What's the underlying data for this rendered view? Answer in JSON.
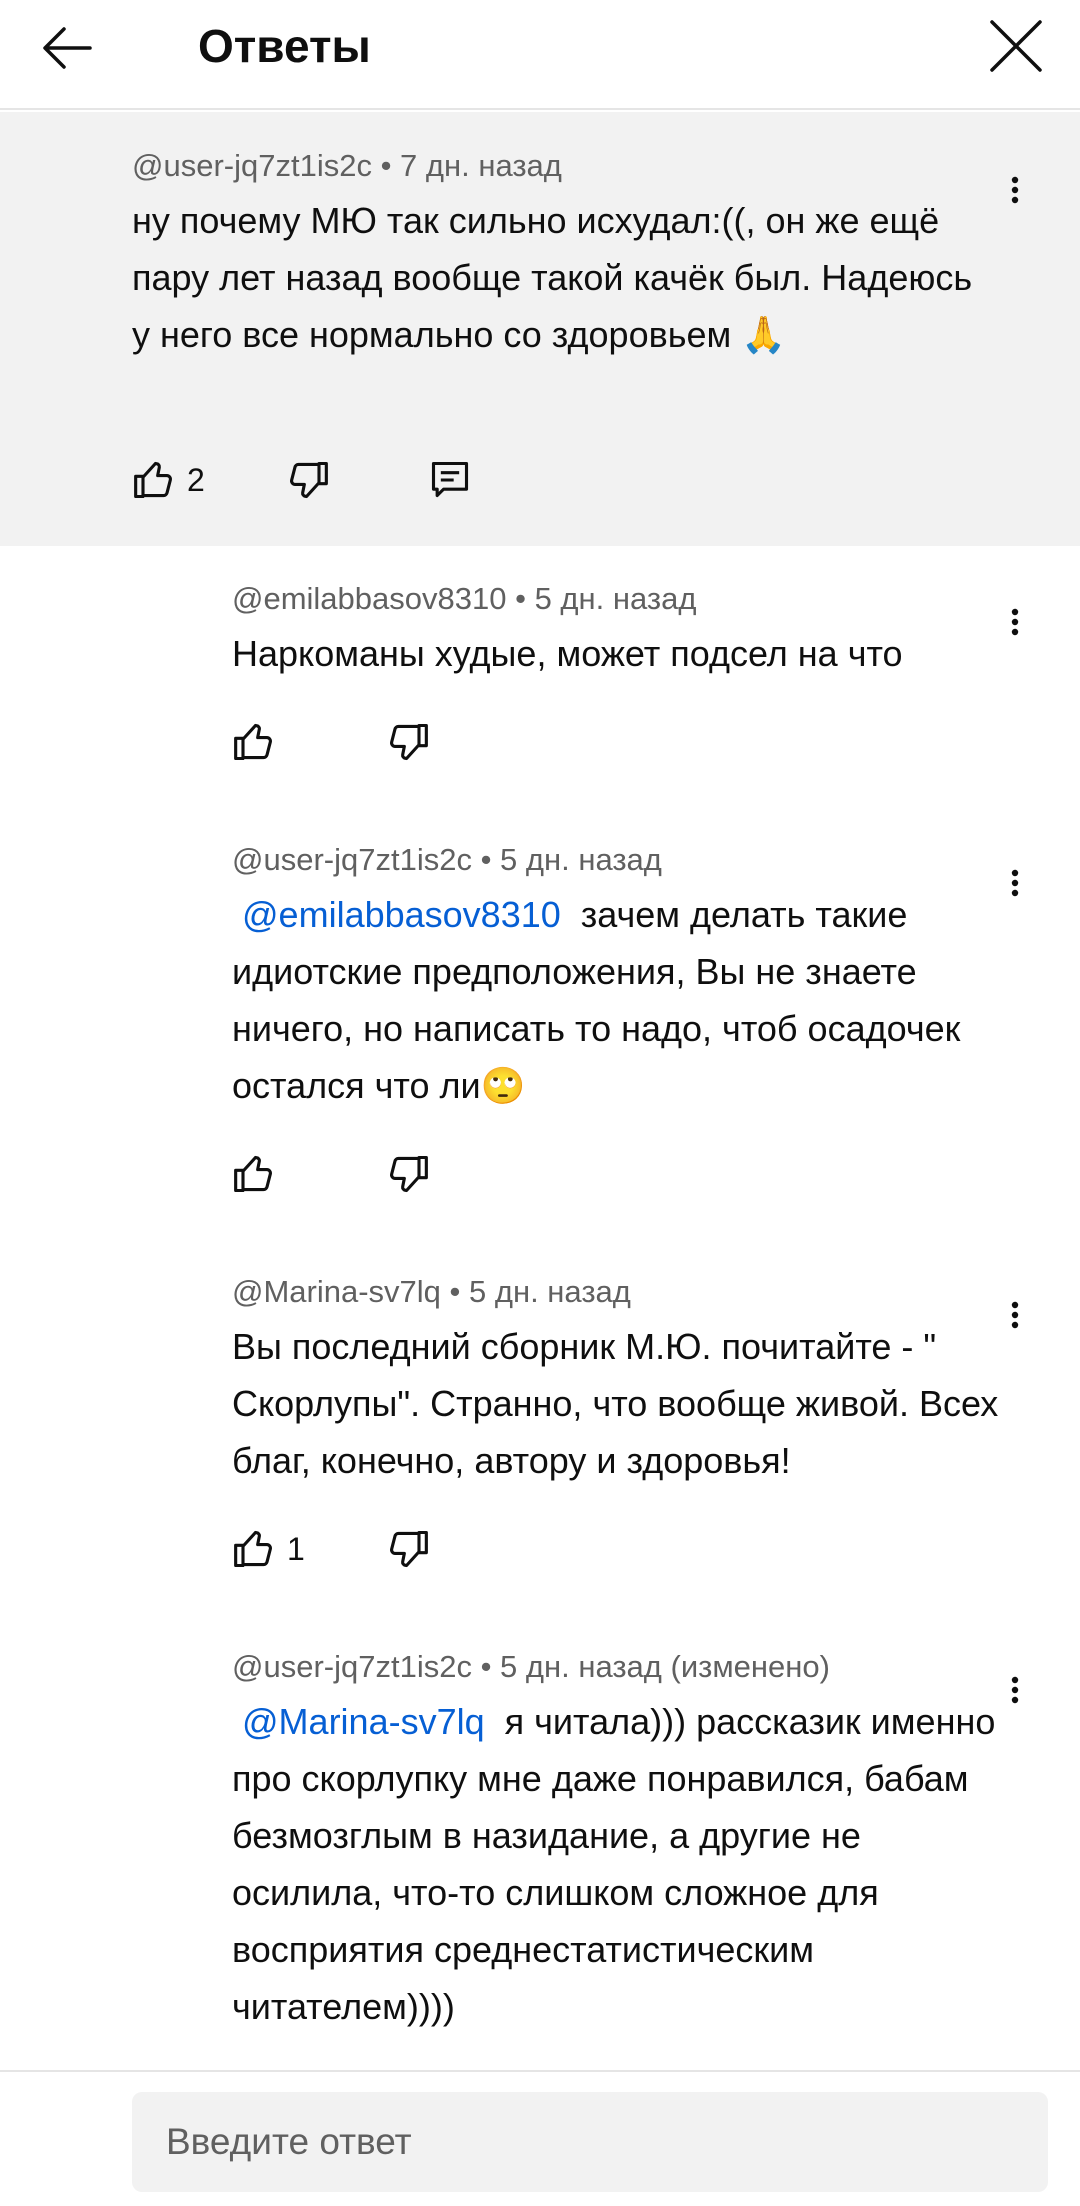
{
  "header": {
    "title": "Ответы"
  },
  "parent": {
    "author": "@user-jq7zt1is2c",
    "time": "7 дн. назад",
    "text": "ну почему МЮ так сильно исхудал:((, он же ещё пару лет назад вообще такой качёк был. Надеюсь у него все нормально со здоровьем 🙏",
    "likes": "2"
  },
  "replies": [
    {
      "author": "@emilabbasov8310",
      "time": "5 дн. назад",
      "mention": "",
      "text": "Наркоманы худые, может подсел на что",
      "likes": ""
    },
    {
      "author": "@user-jq7zt1is2c",
      "time": "5 дн. назад",
      "mention": "@emilabbasov8310",
      "text": "зачем делать такие идиотские предположения, Вы не знаете ничего,  но написать то надо, чтоб осадочек остался что ли🙄",
      "likes": ""
    },
    {
      "author": "@Marina-sv7lq",
      "time": "5 дн. назад",
      "mention": "",
      "text": "Вы последний сборник М.Ю. почитайте - \" Скорлупы\". Странно, что вообще живой. Всех благ, конечно, автору и здоровья!",
      "likes": "1"
    },
    {
      "author": "@user-jq7zt1is2c",
      "time": "5 дн. назад (изменено)",
      "mention": "@Marina-sv7lq",
      "text": "я читала))) рассказик именно про скорлупку мне даже понравился, бабам безмозглым  в назидание, а другие не осилила, что-то слишком сложное для восприятия среднестатистическим читателем))))",
      "likes": ""
    }
  ],
  "reply_box": {
    "placeholder": "Введите ответ"
  },
  "separator": " • ",
  "icons": [
    "back-arrow-icon",
    "close-icon",
    "more-vert-icon",
    "thumb-up-icon",
    "thumb-down-icon",
    "reply-icon"
  ]
}
